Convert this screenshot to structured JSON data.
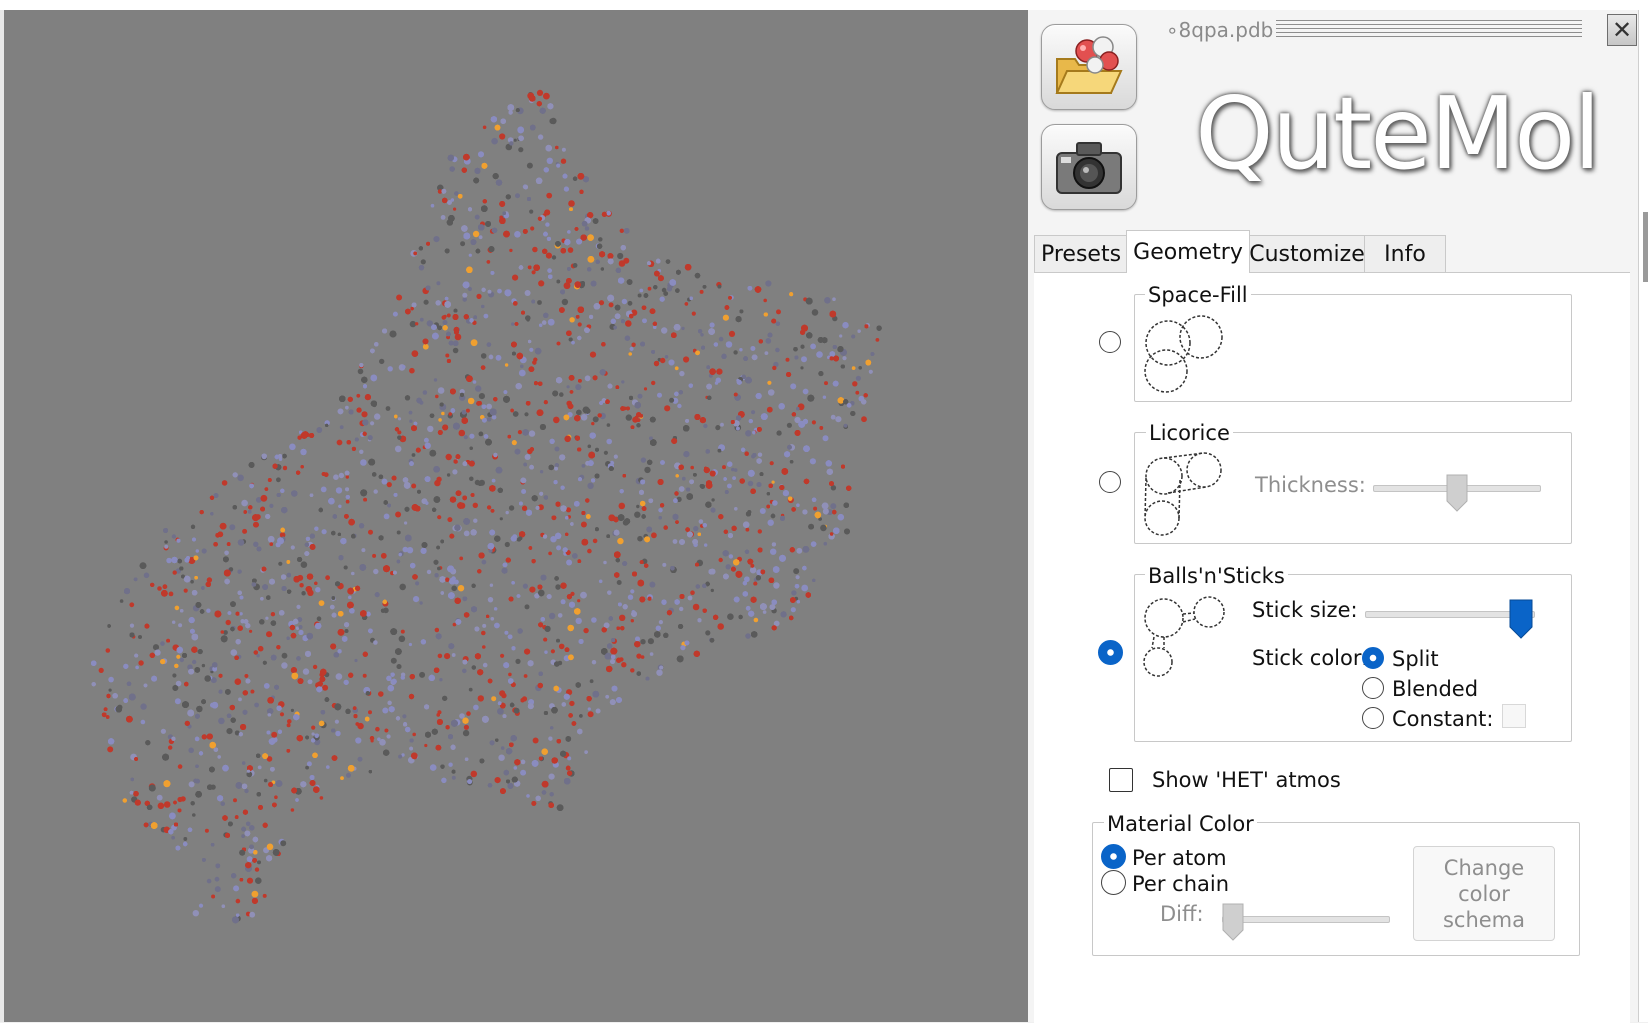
{
  "window": {
    "filename": "∘8qpa.pdb",
    "close_icon": "close-icon"
  },
  "toolbar": {
    "open_icon": "open-folder-molecule-icon",
    "snapshot_icon": "camera-icon"
  },
  "logo": {
    "text": "QuteMol"
  },
  "tabs": [
    {
      "label": "Presets",
      "active": false
    },
    {
      "label": "Geometry",
      "active": true
    },
    {
      "label": "Customize",
      "active": false
    },
    {
      "label": "Info",
      "active": false
    }
  ],
  "geometry": {
    "spacefill": {
      "title": "Space-Fill",
      "selected": false
    },
    "licorice": {
      "title": "Licorice",
      "selected": false,
      "thickness_label": "Thickness:",
      "thickness_value": 0.5
    },
    "ballsnsticks": {
      "title": "Balls'n'Sticks",
      "selected": true,
      "stick_size_label": "Stick size:",
      "stick_size_value": 0.95,
      "stick_color_label": "Stick color:",
      "options": [
        {
          "label": "Split",
          "selected": true
        },
        {
          "label": "Blended",
          "selected": false
        },
        {
          "label": "Constant:",
          "selected": false
        }
      ]
    },
    "show_het": {
      "label": "Show 'HET' atmos",
      "checked": false
    },
    "material_color": {
      "title": "Material Color",
      "per_atom": {
        "label": "Per atom",
        "selected": true
      },
      "per_chain": {
        "label": "Per chain",
        "selected": false
      },
      "diff_label": "Diff:",
      "diff_value": 0.0,
      "change_color_button": "Change color schema"
    }
  },
  "colors": {
    "viewport_bg": "#808080",
    "accent": "#0a64c8",
    "atom_oxygen": "#c0392b",
    "atom_nitrogen": "#8a8cc0",
    "atom_sulfur": "#f0a030"
  }
}
